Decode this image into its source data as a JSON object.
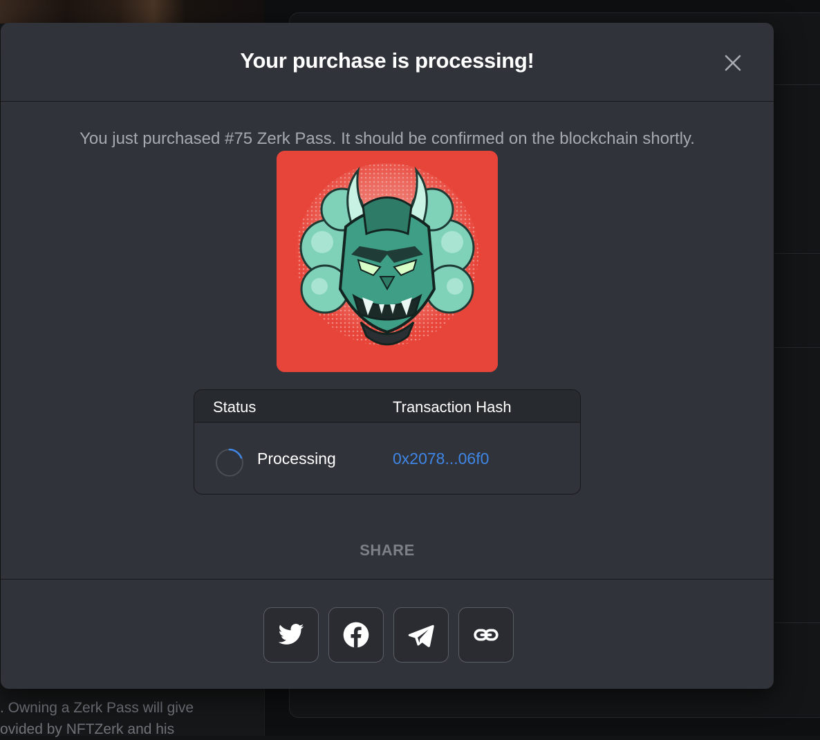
{
  "background": {
    "description_lines": [
      ". Owning a Zerk Pass will give",
      "ovided by NFTZerk and his"
    ]
  },
  "modal": {
    "title": "Your purchase is processing!",
    "message": "You just purchased #75 Zerk Pass. It should be confirmed on the blockchain shortly.",
    "nft_image_icon": "oni-demon-mask-artwork",
    "table": {
      "status_header": "Status",
      "hash_header": "Transaction Hash",
      "status_value": "Processing",
      "hash_value": "0x2078...06f0"
    },
    "share_label": "SHARE",
    "share_buttons": [
      {
        "icon": "twitter-icon"
      },
      {
        "icon": "facebook-icon"
      },
      {
        "icon": "telegram-icon"
      },
      {
        "icon": "link-icon"
      }
    ]
  },
  "colors": {
    "modal_bg": "#303339",
    "nft_bg": "#e8453a",
    "link": "#3f86e6",
    "muted_text": "#a6aab0"
  }
}
